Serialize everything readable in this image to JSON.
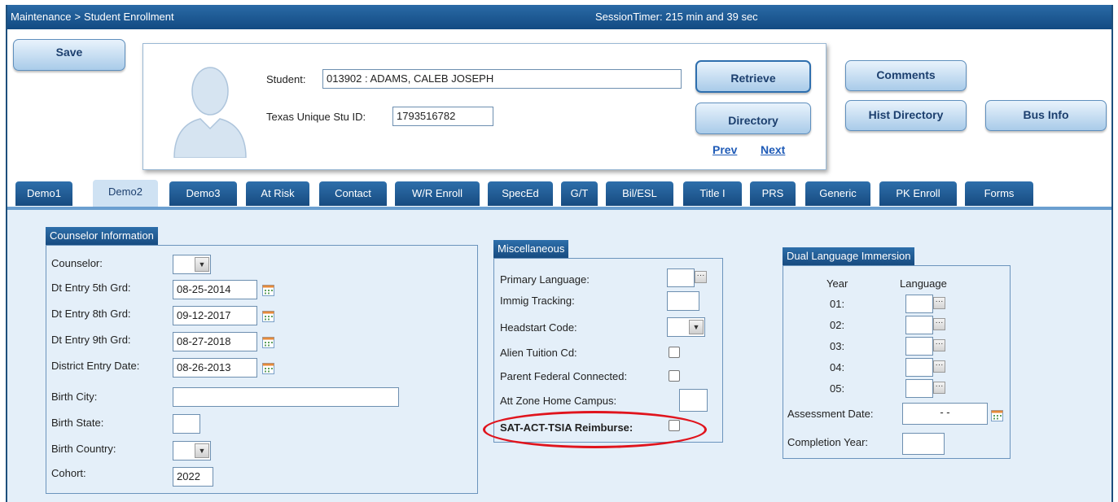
{
  "titlebar": {
    "breadcrumb_section": "Maintenance",
    "breadcrumb_separator": ">",
    "breadcrumb_page": "Student Enrollment",
    "session_timer": "SessionTimer: 215 min and 39 sec"
  },
  "toolbar": {
    "save_label": "Save",
    "retrieve_label": "Retrieve",
    "directory_label": "Directory",
    "prev_label": "Prev",
    "next_label": "Next",
    "comments_label": "Comments",
    "hist_directory_label": "Hist Directory",
    "bus_info_label": "Bus Info"
  },
  "student": {
    "student_label": "Student:",
    "student_value": "013902 : ADAMS, CALEB JOSEPH",
    "tsid_label": "Texas Unique Stu ID:",
    "tsid_value": "1793516782"
  },
  "tabs": [
    {
      "label": "Demo1",
      "active": false
    },
    {
      "label": "Demo2",
      "active": true
    },
    {
      "label": "Demo3",
      "active": false
    },
    {
      "label": "At Risk",
      "active": false
    },
    {
      "label": "Contact",
      "active": false
    },
    {
      "label": "W/R Enroll",
      "active": false
    },
    {
      "label": "SpecEd",
      "active": false
    },
    {
      "label": "G/T",
      "active": false
    },
    {
      "label": "Bil/ESL",
      "active": false
    },
    {
      "label": "Title I",
      "active": false
    },
    {
      "label": "PRS",
      "active": false
    },
    {
      "label": "Generic",
      "active": false
    },
    {
      "label": "PK Enroll",
      "active": false
    },
    {
      "label": "Forms",
      "active": false
    }
  ],
  "counselor": {
    "title": "Counselor Information",
    "counselor_label": "Counselor:",
    "dt5_label": "Dt Entry 5th Grd:",
    "dt5_value": "08-25-2014",
    "dt8_label": "Dt Entry 8th Grd:",
    "dt8_value": "09-12-2017",
    "dt9_label": "Dt Entry 9th Grd:",
    "dt9_value": "08-27-2018",
    "district_label": "District Entry Date:",
    "district_value": "08-26-2013",
    "birth_city_label": "Birth City:",
    "birth_city_value": "",
    "birth_state_label": "Birth State:",
    "birth_state_value": "",
    "birth_country_label": "Birth Country:",
    "cohort_label": "Cohort:",
    "cohort_value": "2022"
  },
  "misc": {
    "title": "Miscellaneous",
    "primary_language_label": "Primary Language:",
    "immig_label": "Immig Tracking:",
    "headstart_label": "Headstart Code:",
    "alien_label": "Alien Tuition Cd:",
    "parent_federal_label": "Parent Federal Connected:",
    "att_zone_label": "Att Zone Home Campus:",
    "sat_label": "SAT-ACT-TSIA Reimburse:"
  },
  "dual": {
    "title": "Dual Language Immersion",
    "year_header": "Year",
    "language_header": "Language",
    "rows": [
      "01:",
      "02:",
      "03:",
      "04:",
      "05:"
    ],
    "assessment_label": "Assessment Date:",
    "assessment_value": "- -",
    "completion_label": "Completion Year:"
  }
}
